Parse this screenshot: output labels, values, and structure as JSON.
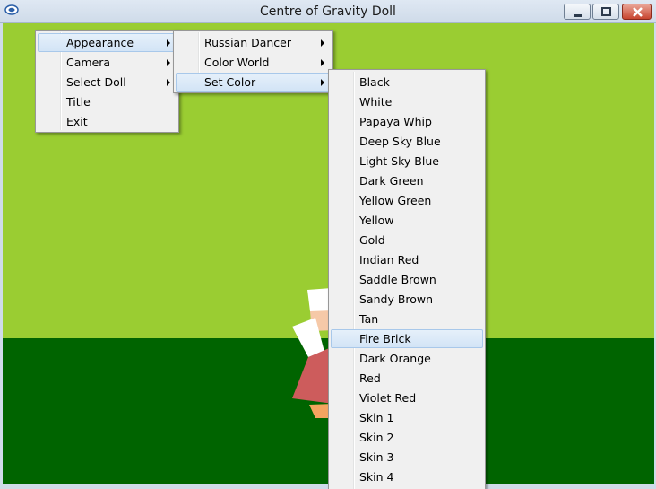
{
  "window": {
    "title": "Centre of Gravity Doll",
    "minimize_icon": "minimize-icon",
    "maximize_icon": "maximize-icon",
    "close_icon": "close-icon"
  },
  "colors": {
    "sky": "#9acd32",
    "ground": "#006400",
    "menu_bg": "#f0f0f0",
    "highlight": "#d3e4f6"
  },
  "menu_main": {
    "items": [
      {
        "label": "Appearance",
        "has_submenu": true,
        "highlighted": true
      },
      {
        "label": "Camera",
        "has_submenu": true,
        "highlighted": false
      },
      {
        "label": "Select Doll",
        "has_submenu": true,
        "highlighted": false
      },
      {
        "label": "Title",
        "has_submenu": false,
        "highlighted": false
      },
      {
        "label": "Exit",
        "has_submenu": false,
        "highlighted": false
      }
    ]
  },
  "menu_appearance": {
    "items": [
      {
        "label": "Russian Dancer",
        "has_submenu": true,
        "highlighted": false
      },
      {
        "label": "Color World",
        "has_submenu": true,
        "highlighted": false
      },
      {
        "label": "Set Color",
        "has_submenu": true,
        "highlighted": true
      }
    ]
  },
  "menu_set_color": {
    "items": [
      {
        "label": "Black",
        "highlighted": false
      },
      {
        "label": "White",
        "highlighted": false
      },
      {
        "label": "Papaya Whip",
        "highlighted": false
      },
      {
        "label": "Deep  Sky Blue",
        "highlighted": false
      },
      {
        "label": "Light Sky Blue",
        "highlighted": false
      },
      {
        "label": "Dark Green",
        "highlighted": false
      },
      {
        "label": "Yellow Green",
        "highlighted": false
      },
      {
        "label": "Yellow",
        "highlighted": false
      },
      {
        "label": "Gold",
        "highlighted": false
      },
      {
        "label": "Indian Red",
        "highlighted": false
      },
      {
        "label": "Saddle Brown",
        "highlighted": false
      },
      {
        "label": "Sandy Brown",
        "highlighted": false
      },
      {
        "label": "Tan",
        "highlighted": false
      },
      {
        "label": "Fire Brick",
        "highlighted": true
      },
      {
        "label": "Dark Orange",
        "highlighted": false
      },
      {
        "label": "Red",
        "highlighted": false
      },
      {
        "label": "Violet Red",
        "highlighted": false
      },
      {
        "label": "Skin 1",
        "highlighted": false
      },
      {
        "label": "Skin 2",
        "highlighted": false
      },
      {
        "label": "Skin 3",
        "highlighted": false
      },
      {
        "label": "Skin 4",
        "highlighted": false
      }
    ]
  }
}
